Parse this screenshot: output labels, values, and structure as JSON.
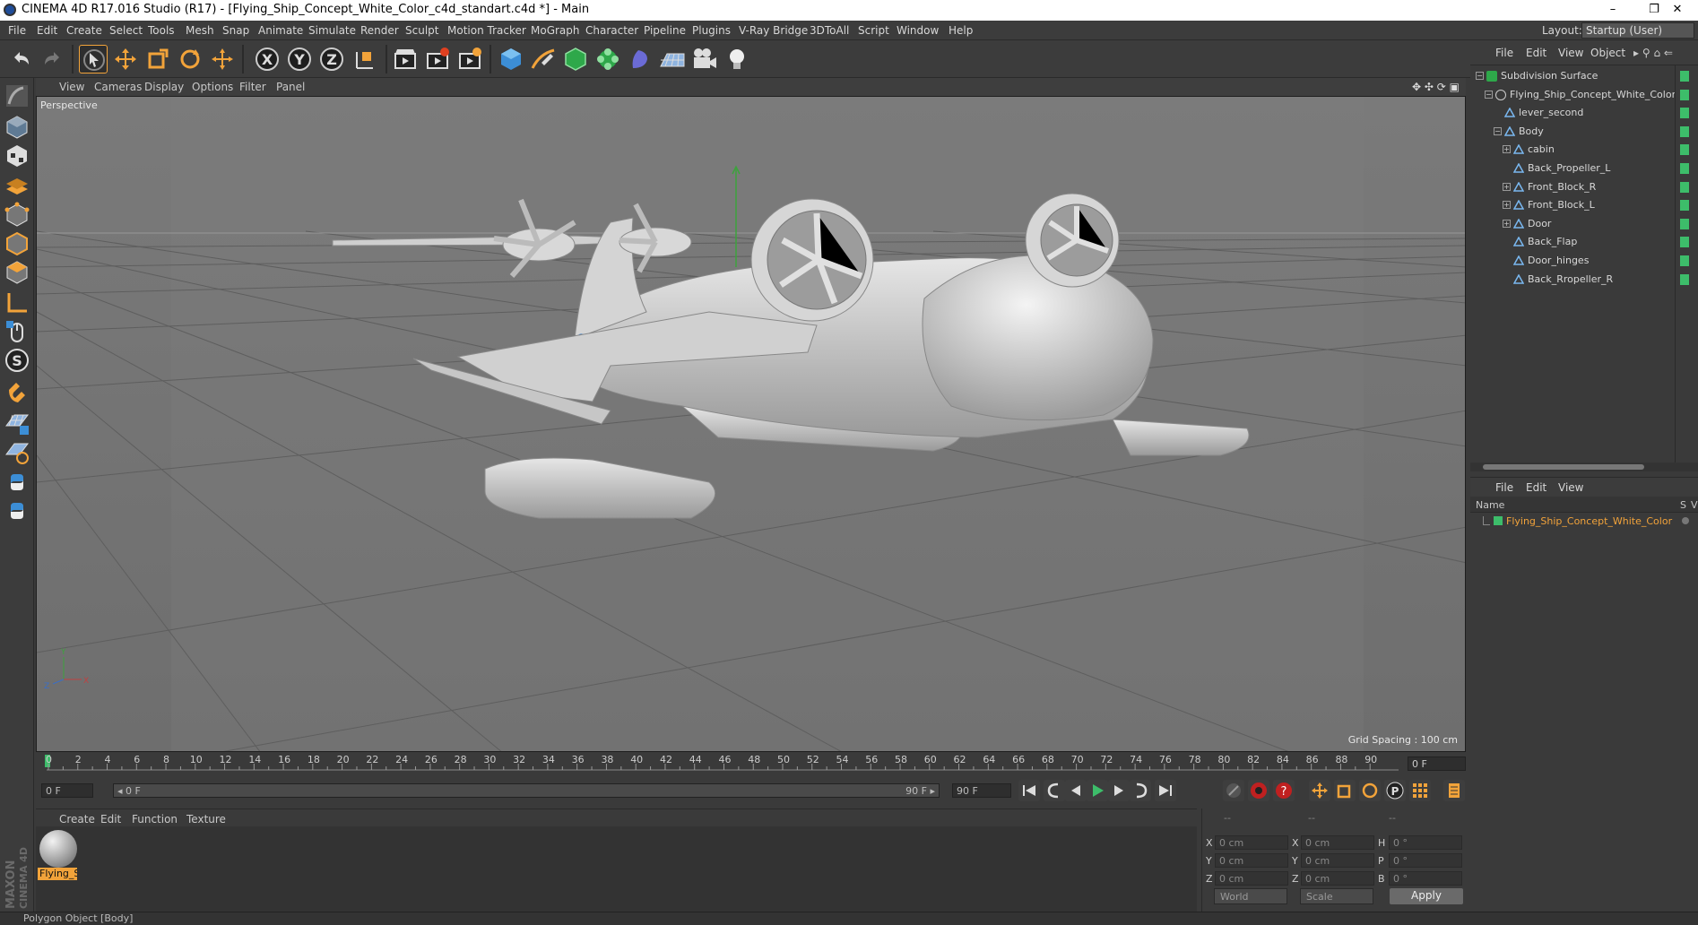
{
  "window": {
    "title": "CINEMA 4D R17.016 Studio (R17) - [Flying_Ship_Concept_White_Color_c4d_standart.c4d *] - Main",
    "minimize": "–",
    "restore": "❐",
    "close": "✕"
  },
  "menu": [
    "File",
    "Edit",
    "Create",
    "Select",
    "Tools",
    "Mesh",
    "Snap",
    "Animate",
    "Simulate",
    "Render",
    "Sculpt",
    "Motion Tracker",
    "MoGraph",
    "Character",
    "Pipeline",
    "Plugins",
    "V-Ray Bridge",
    "3DToAll",
    "Script",
    "Window",
    "Help"
  ],
  "layout": {
    "label": "Layout:",
    "value": "Startup (User)"
  },
  "viewport": {
    "menu": [
      "View",
      "Cameras",
      "Display",
      "Options",
      "Filter",
      "Panel"
    ],
    "label": "Perspective",
    "grid_spacing": "Grid Spacing : 100 cm",
    "axes": {
      "x": "X",
      "y": "Y",
      "z": "Z"
    }
  },
  "timeline": {
    "ticks": [
      "0",
      "2",
      "4",
      "6",
      "8",
      "10",
      "12",
      "14",
      "16",
      "18",
      "20",
      "22",
      "24",
      "26",
      "28",
      "30",
      "32",
      "34",
      "36",
      "38",
      "40",
      "42",
      "44",
      "46",
      "48",
      "50",
      "52",
      "54",
      "56",
      "58",
      "60",
      "62",
      "64",
      "66",
      "68",
      "70",
      "72",
      "74",
      "76",
      "78",
      "80",
      "82",
      "84",
      "86",
      "88",
      "90"
    ],
    "current_frame": "0 F",
    "start": "0 F",
    "range_start": "◂ 0 F",
    "range_end": "90 F ▸",
    "end": "90 F"
  },
  "materials": {
    "menu": [
      "Create",
      "Edit",
      "Function",
      "Texture"
    ],
    "items": [
      {
        "name": "Flying_S"
      }
    ]
  },
  "coordinates": {
    "header": [
      "--",
      "--",
      "--"
    ],
    "rows": [
      {
        "axis": "X",
        "pos": "0 cm",
        "axis2": "X",
        "size": "0 cm",
        "rot_label": "H",
        "rot": "0 °"
      },
      {
        "axis": "Y",
        "pos": "0 cm",
        "axis2": "Y",
        "size": "0 cm",
        "rot_label": "P",
        "rot": "0 °"
      },
      {
        "axis": "Z",
        "pos": "0 cm",
        "axis2": "Z",
        "size": "0 cm",
        "rot_label": "B",
        "rot": "0 °"
      }
    ],
    "mode1": "World",
    "mode2": "Scale",
    "apply": "Apply"
  },
  "object_manager": {
    "menu": [
      "File",
      "Edit",
      "View",
      "Object"
    ],
    "tree": [
      {
        "label": "Subdivision Surface",
        "depth": 0,
        "icon": "subdivision-icon",
        "expander": "−"
      },
      {
        "label": "Flying_Ship_Concept_White_Color",
        "depth": 1,
        "icon": "null-object-icon",
        "expander": "−"
      },
      {
        "label": "lever_second",
        "depth": 2,
        "icon": "polygon-icon",
        "expander": ""
      },
      {
        "label": "Body",
        "depth": 2,
        "icon": "polygon-icon",
        "expander": "−"
      },
      {
        "label": "cabin",
        "depth": 3,
        "icon": "polygon-icon",
        "expander": "+"
      },
      {
        "label": "Back_Propeller_L",
        "depth": 3,
        "icon": "polygon-icon",
        "expander": ""
      },
      {
        "label": "Front_Block_R",
        "depth": 3,
        "icon": "polygon-icon",
        "expander": "+"
      },
      {
        "label": "Front_Block_L",
        "depth": 3,
        "icon": "polygon-icon",
        "expander": "+"
      },
      {
        "label": "Door",
        "depth": 3,
        "icon": "polygon-icon",
        "expander": "+"
      },
      {
        "label": "Back_Flap",
        "depth": 3,
        "icon": "polygon-icon",
        "expander": ""
      },
      {
        "label": "Door_hinges",
        "depth": 3,
        "icon": "polygon-icon",
        "expander": ""
      },
      {
        "label": "Back_Rropeller_R",
        "depth": 3,
        "icon": "polygon-icon",
        "expander": ""
      }
    ]
  },
  "layer_manager": {
    "menu": [
      "File",
      "Edit",
      "View"
    ],
    "columns": {
      "name": "Name",
      "s": "S",
      "v": "V"
    },
    "items": [
      {
        "label": "Flying_Ship_Concept_White_Color"
      }
    ]
  },
  "status": "Polygon Object [Body]",
  "brand": {
    "line1": "MAXON",
    "line2": "CINEMA 4D"
  },
  "colors": {
    "accent_orange": "#f2a33a",
    "active_green": "#3dbd6a",
    "viewport_bg": "#767676"
  }
}
